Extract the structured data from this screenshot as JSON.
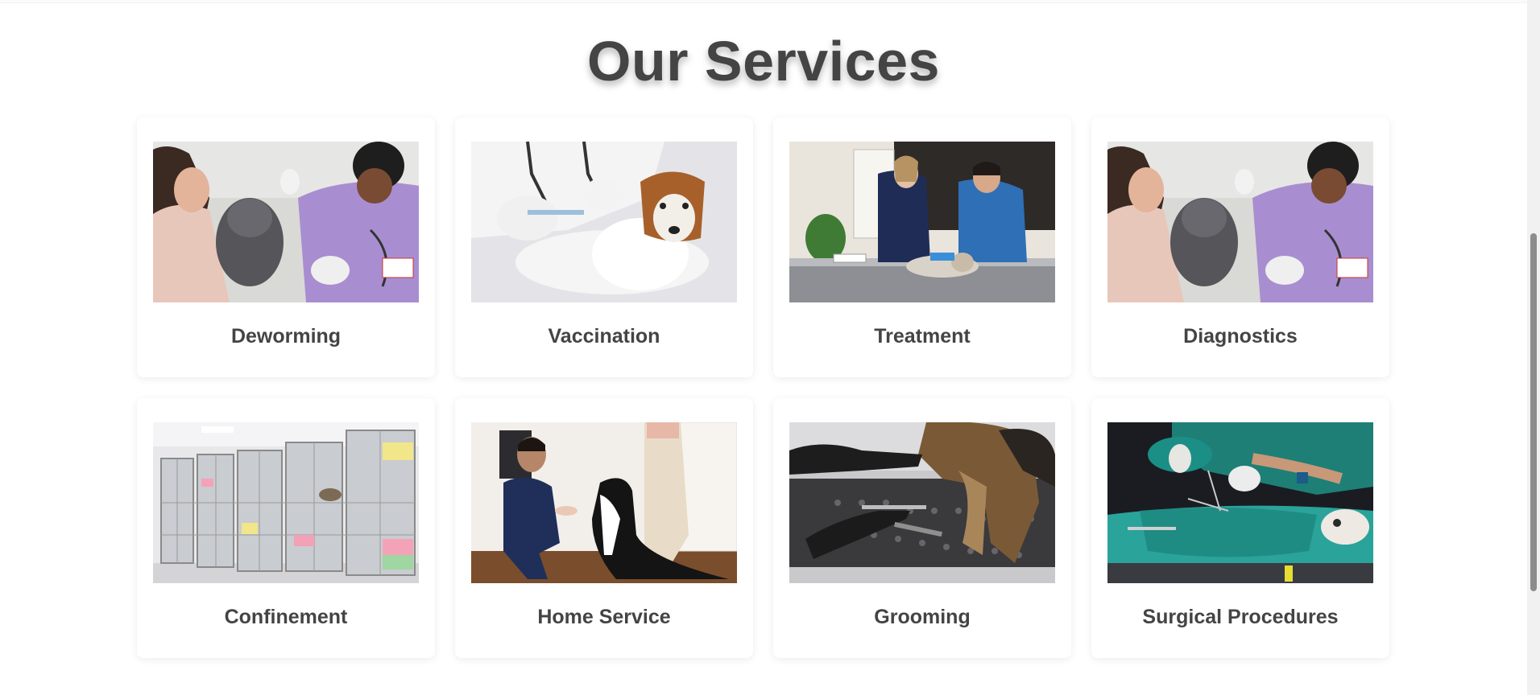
{
  "section": {
    "title": "Our Services"
  },
  "services": [
    {
      "label": "Deworming",
      "image": "vet-holding-rabbit-photo"
    },
    {
      "label": "Vaccination",
      "image": "dog-vaccination-photo"
    },
    {
      "label": "Treatment",
      "image": "vets-treating-cat-photo"
    },
    {
      "label": "Diagnostics",
      "image": "vet-holding-rabbit-photo"
    },
    {
      "label": "Confinement",
      "image": "animal-cages-photo"
    },
    {
      "label": "Home Service",
      "image": "vet-with-dog-home-photo"
    },
    {
      "label": "Grooming",
      "image": "dog-grooming-photo"
    },
    {
      "label": "Surgical Procedures",
      "image": "cat-surgery-photo"
    }
  ],
  "colors": {
    "heading": "#444444",
    "background": "#ffffff",
    "card": "#ffffff"
  }
}
